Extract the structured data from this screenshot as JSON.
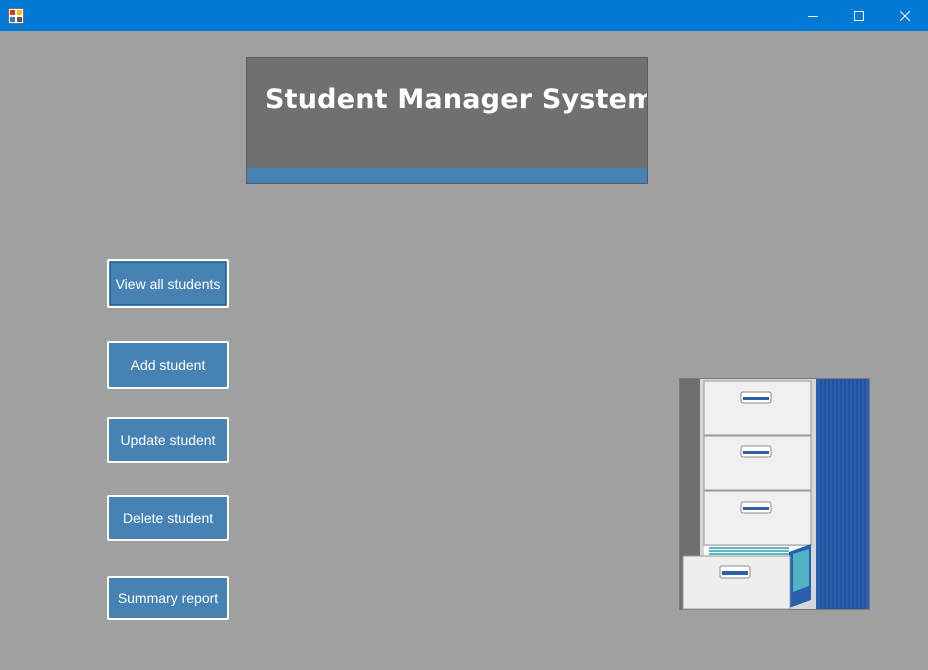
{
  "window": {
    "title": "",
    "controls": {
      "minimize": "minimize",
      "maximize": "maximize",
      "close": "close"
    }
  },
  "header": {
    "title": "Student Manager System",
    "panel_color": "#707070",
    "accent_color": "#4682b4"
  },
  "menu": {
    "view_all": "View all students",
    "add": "Add student",
    "update": "Update student",
    "delete": "Delete student",
    "summary": "Summary report"
  },
  "illustration": {
    "icon": "filing-cabinet-icon"
  },
  "colors": {
    "titlebar": "#0078d4",
    "background": "#a0a0a0",
    "button": "#4682b4",
    "button_text": "#ffffff"
  }
}
